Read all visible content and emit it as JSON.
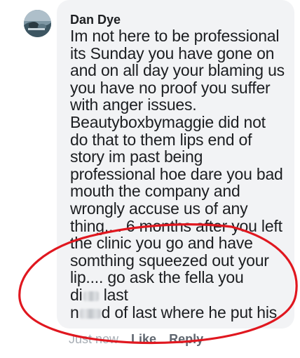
{
  "comment": {
    "author": "Dan Dye",
    "lines": [
      "Im not here to be professional",
      "its Sunday you have gone on",
      "and on all day your blaming us",
      "you have no proof you suffer",
      "with anger issues.",
      "Beautyboxbymaggie did not",
      "do that to them lips end of",
      "story im past being",
      "professional hoe dare you bad",
      "mouth the company and",
      "wrongly accuse us of any",
      "thing.... 6 months after you left",
      "the clinic you go and have",
      "somthing squeezed out your",
      "lip.... go ask the fella you"
    ],
    "line16_before": "n",
    "line16_after": "d of last where he put his",
    "line17_before": "di",
    "line17_after": " last",
    "timestamp": "Just now",
    "like_label": "Like",
    "reply_label": "Reply"
  },
  "colors": {
    "bubble": "#f2f3f5",
    "text": "#1c1e21",
    "meta": "#606770",
    "annotation": "#e0171f"
  },
  "icons": {
    "avatar": "profile-photo"
  }
}
